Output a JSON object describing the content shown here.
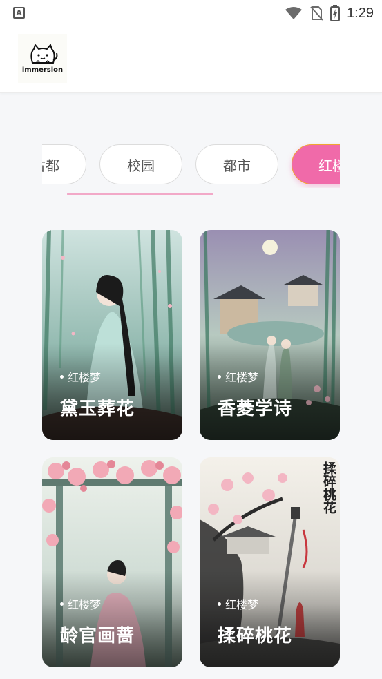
{
  "status_bar": {
    "time": "1:29",
    "notification_letter": "A"
  },
  "header": {
    "logo_text": "immersion"
  },
  "tabs": [
    {
      "label": "古都",
      "partial": true
    },
    {
      "label": "校园"
    },
    {
      "label": "都市"
    },
    {
      "label": "红楼梦",
      "active": true
    }
  ],
  "cards": [
    {
      "category": "红楼梦",
      "title": "黛玉葬花",
      "scene": "bamboo-forest"
    },
    {
      "category": "红楼梦",
      "title": "香菱学诗",
      "scene": "moonlit-pavilion"
    },
    {
      "category": "红楼梦",
      "title": "龄官画蔷",
      "scene": "rose-trellis"
    },
    {
      "category": "红楼梦",
      "title": "揉碎桃花",
      "scene": "plum-blossom-sword",
      "stamp": "揉碎桃花"
    }
  ],
  "colors": {
    "accent": "#f06aa9",
    "indicator": "#f2a9c8",
    "background": "#f6f7f9"
  }
}
